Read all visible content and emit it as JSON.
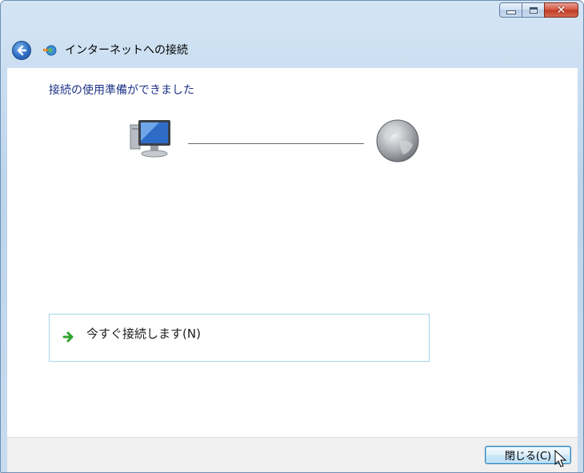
{
  "window": {
    "title": "インターネットへの接続",
    "caption_buttons": {
      "minimize": "minimize-icon",
      "maximize": "maximize-icon",
      "close": "close-icon"
    }
  },
  "nav": {
    "back_icon": "back-arrow-icon",
    "app_icon": "network-globe-icon"
  },
  "content": {
    "heading": "接続の使用準備ができました",
    "diagram": {
      "left_icon": "computer-icon",
      "right_icon": "globe-icon"
    },
    "task": {
      "label": "今すぐ接続します(N)",
      "icon": "green-arrow-icon"
    }
  },
  "footer": {
    "close_label": "閉じる(C)"
  },
  "colors": {
    "heading": "#1e3287",
    "task_border": "#a6d6ea",
    "button_border": "#3c7fb1"
  }
}
